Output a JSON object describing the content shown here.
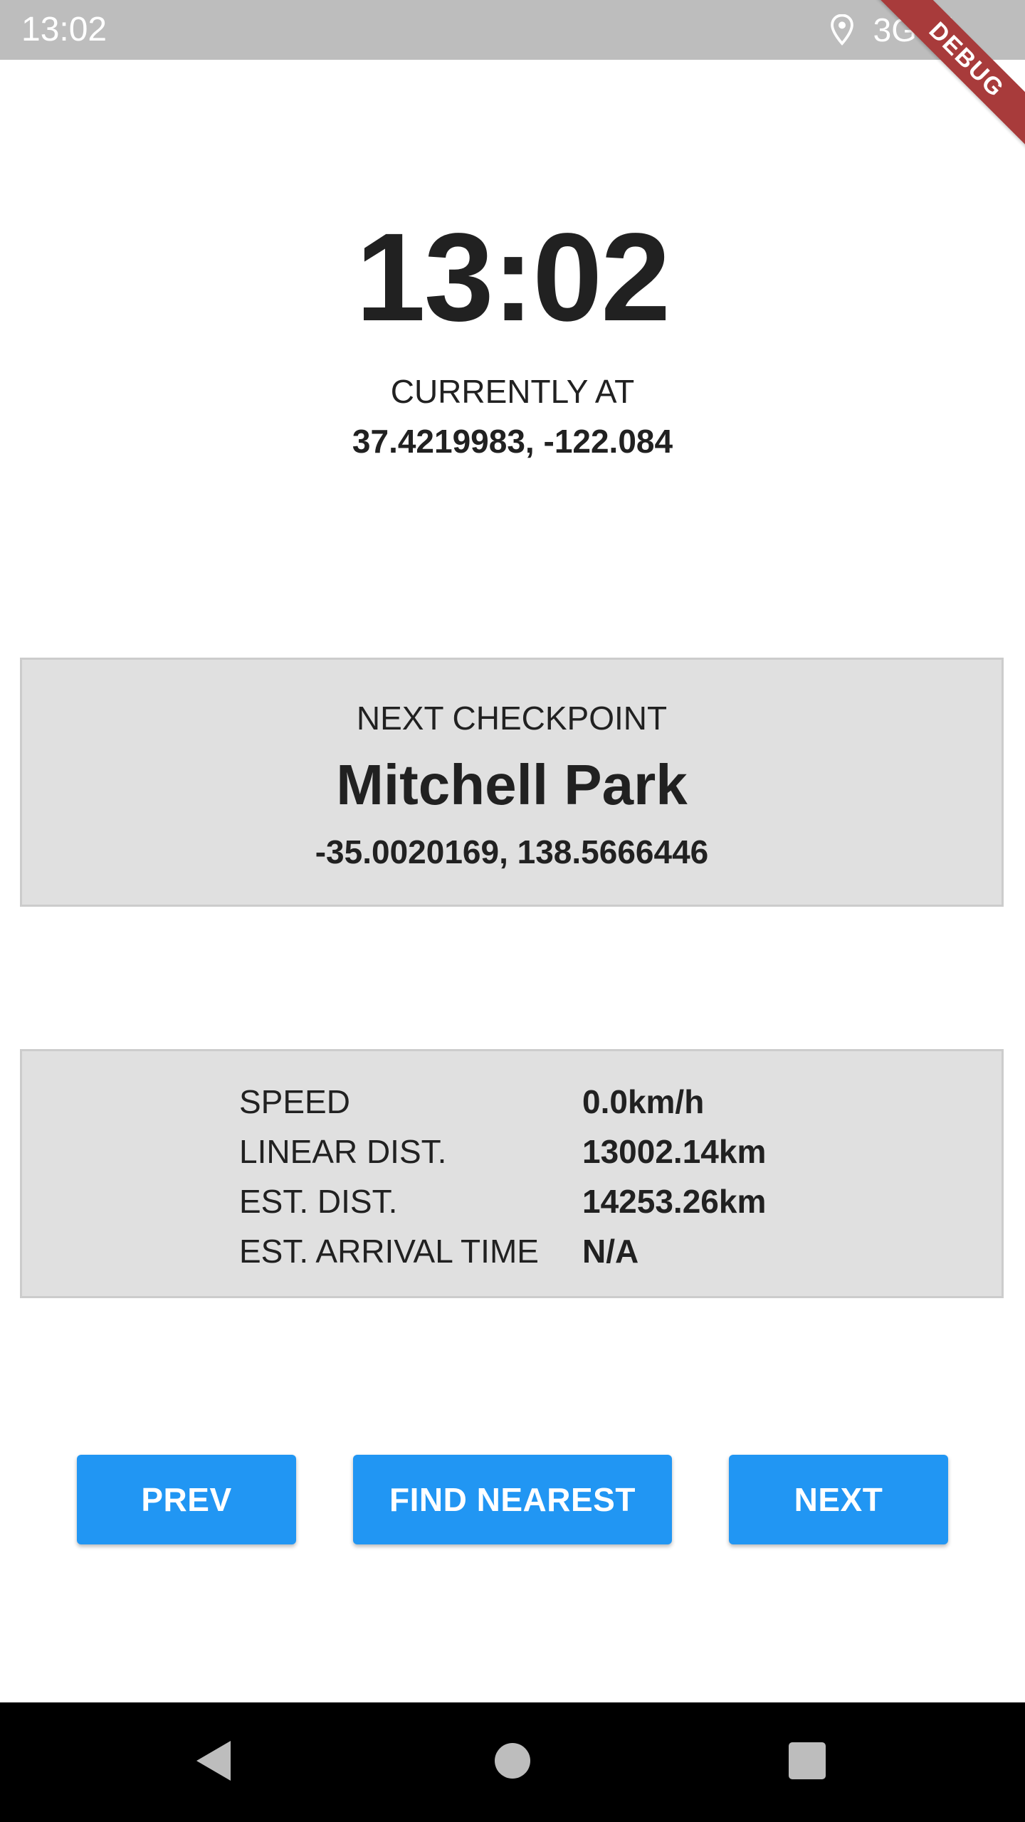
{
  "status_bar": {
    "time": "13:02",
    "network": "3G",
    "icons": [
      "location-icon",
      "signal-icon"
    ]
  },
  "debug_banner": "DEBUG",
  "clock": "13:02",
  "current": {
    "label": "CURRENTLY AT",
    "coords": "37.4219983, -122.084"
  },
  "checkpoint": {
    "label": "NEXT CHECKPOINT",
    "name": "Mitchell Park",
    "coords": "-35.0020169, 138.5666446"
  },
  "stats": [
    {
      "label": "SPEED",
      "value": "0.0km/h"
    },
    {
      "label": "LINEAR DIST.",
      "value": "13002.14km"
    },
    {
      "label": "EST. DIST.",
      "value": "14253.26km"
    },
    {
      "label": "EST. ARRIVAL TIME",
      "value": "N/A"
    }
  ],
  "buttons": {
    "prev": "PREV",
    "find_nearest": "FIND NEAREST",
    "next": "NEXT"
  },
  "nav": {
    "icons": [
      "back-icon",
      "home-icon",
      "recents-icon"
    ]
  },
  "colors": {
    "status_bar": "#bdbdbd",
    "card_bg": "#e0e0e0",
    "button": "#2196f3",
    "debug_ribbon": "#a83b3b",
    "text": "#212121"
  }
}
